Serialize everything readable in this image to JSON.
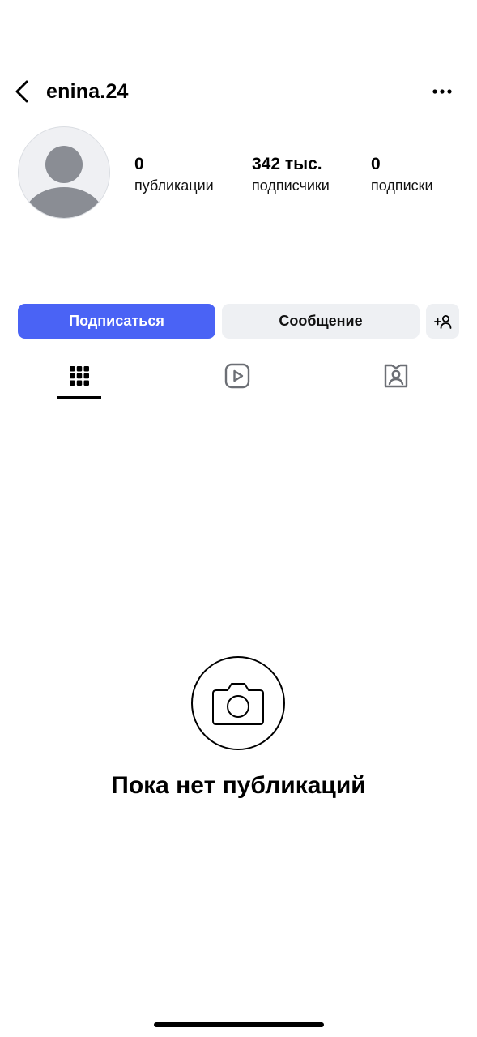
{
  "header": {
    "username": "enina.24",
    "back_icon": "chevron-left-icon",
    "more_icon": "more-horizontal-icon"
  },
  "profile": {
    "avatar_icon": "default-avatar-icon",
    "stats": [
      {
        "value": "0",
        "label": "публикации"
      },
      {
        "value": "342 тыс.",
        "label": "подписчики"
      },
      {
        "value": "0",
        "label": "подписки"
      }
    ]
  },
  "actions": {
    "follow_label": "Подписаться",
    "message_label": "Сообщение",
    "add_person_icon": "add-person-icon",
    "accent_color": "#4a63f5"
  },
  "tabs": [
    {
      "icon": "grid-icon",
      "active": true
    },
    {
      "icon": "reels-icon",
      "active": false
    },
    {
      "icon": "tagged-icon",
      "active": false
    }
  ],
  "empty_state": {
    "icon": "camera-icon",
    "title": "Пока нет публикаций"
  }
}
